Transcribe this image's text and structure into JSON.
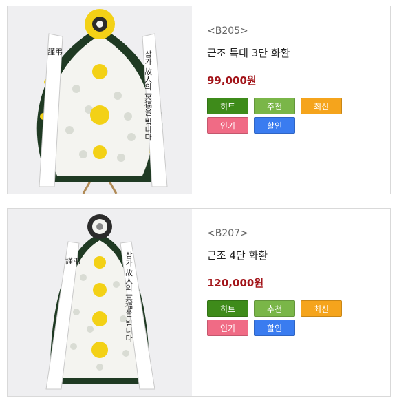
{
  "products": [
    {
      "code": "<B205>",
      "name": "근조 특대 3단 화환",
      "price": "99,000원",
      "image_alt": "근조 특대 3단 화환",
      "ribbon_left": "謹弔",
      "ribbon_right": "삼가 故人의 冥福을 빕니다",
      "badges": [
        {
          "label": "히트",
          "color": "#3e8b1a"
        },
        {
          "label": "추천",
          "color": "#7ab648"
        },
        {
          "label": "최신",
          "color": "#f5a41c"
        },
        {
          "label": "인기",
          "color": "#f06b85"
        },
        {
          "label": "할인",
          "color": "#3a7cf0"
        }
      ]
    },
    {
      "code": "<B207>",
      "name": "근조 4단 화환",
      "price": "120,000원",
      "image_alt": "근조 4단 화환",
      "ribbon_left": "謹弔",
      "ribbon_right": "삼가 故人의 冥福을 빕니다",
      "badges": [
        {
          "label": "히트",
          "color": "#3e8b1a"
        },
        {
          "label": "추천",
          "color": "#7ab648"
        },
        {
          "label": "최신",
          "color": "#f5a41c"
        },
        {
          "label": "인기",
          "color": "#f06b85"
        },
        {
          "label": "할인",
          "color": "#3a7cf0"
        }
      ]
    }
  ],
  "colors": {
    "price": "#a3161b",
    "wreath_white": "#f4f4f0",
    "wreath_green": "#1f3a23",
    "wreath_yellow": "#f3d116"
  }
}
